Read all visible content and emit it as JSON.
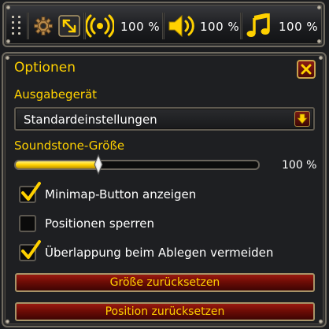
{
  "toolbar": {
    "icons": [
      "grip-dots-icon",
      "gear-icon",
      "resize-arrows-icon",
      "broadcast-signal-icon",
      "speaker-icon",
      "music-note-icon"
    ],
    "ambience_volume": "100 %",
    "sound_volume": "100 %",
    "music_volume": "100 %"
  },
  "panel": {
    "title": "Optionen",
    "close_icon": "close-x-icon",
    "output_device": {
      "label": "Ausgabegerät",
      "selected": "Standardeinstellungen",
      "dropdown_icon": "arrow-down-icon"
    },
    "size": {
      "label": "Soundstone-Größe",
      "value_text": "100 %",
      "fill_fraction": 0.34
    },
    "checkboxes": [
      {
        "label": "Minimap-Button anzeigen",
        "checked": true
      },
      {
        "label": "Positionen sperren",
        "checked": false
      },
      {
        "label": "Überlappung beim Ablegen vermeiden",
        "checked": true
      }
    ],
    "buttons": {
      "reset_size": "Größe zurücksetzen",
      "reset_position": "Position zurücksetzen"
    }
  },
  "colors": {
    "accent_gold": "#ffd100",
    "button_red": "#7a0e08",
    "border": "#6f6a60",
    "background": "#1e1f22"
  }
}
